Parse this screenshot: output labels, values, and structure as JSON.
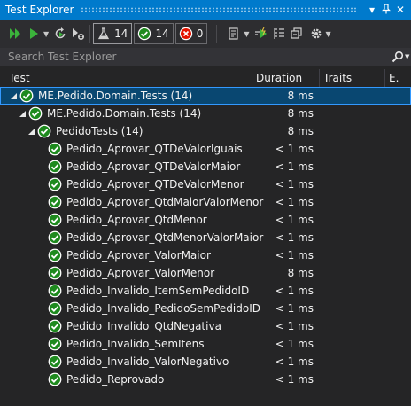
{
  "window": {
    "title": "Test Explorer"
  },
  "toolbar": {
    "passed_count": "14",
    "failed_count": "0",
    "total_count": "14"
  },
  "search": {
    "placeholder": "Search Test Explorer"
  },
  "columns": [
    "Test",
    "Duration",
    "Traits",
    "E."
  ],
  "rows": [
    {
      "name": "ME.Pedido.Domain.Tests (14)",
      "duration": "8 ms"
    },
    {
      "name": "ME.Pedido.Domain.Tests (14)",
      "duration": "8 ms"
    },
    {
      "name": "PedidoTests (14)",
      "duration": "8 ms"
    },
    {
      "name": "Pedido_Aprovar_QTDeValorIguais",
      "duration": "< 1 ms"
    },
    {
      "name": "Pedido_Aprovar_QTDeValorMaior",
      "duration": "< 1 ms"
    },
    {
      "name": "Pedido_Aprovar_QTDeValorMenor",
      "duration": "< 1 ms"
    },
    {
      "name": "Pedido_Aprovar_QtdMaiorValorMenor",
      "duration": "< 1 ms"
    },
    {
      "name": "Pedido_Aprovar_QtdMenor",
      "duration": "< 1 ms"
    },
    {
      "name": "Pedido_Aprovar_QtdMenorValorMaior",
      "duration": "< 1 ms"
    },
    {
      "name": "Pedido_Aprovar_ValorMaior",
      "duration": "< 1 ms"
    },
    {
      "name": "Pedido_Aprovar_ValorMenor",
      "duration": "8 ms"
    },
    {
      "name": "Pedido_Invalido_ItemSemPedidoID",
      "duration": "< 1 ms"
    },
    {
      "name": "Pedido_Invalido_PedidoSemPedidoID",
      "duration": "< 1 ms"
    },
    {
      "name": "Pedido_Invalido_QtdNegativa",
      "duration": "< 1 ms"
    },
    {
      "name": "Pedido_Invalido_SemItens",
      "duration": "< 1 ms"
    },
    {
      "name": "Pedido_Invalido_ValorNegativo",
      "duration": "< 1 ms"
    },
    {
      "name": "Pedido_Reprovado",
      "duration": "< 1 ms"
    }
  ],
  "colors": {
    "accent": "#007acc",
    "passed": "#1e8a1e",
    "failed": "#e51400",
    "selection": "#094771"
  }
}
